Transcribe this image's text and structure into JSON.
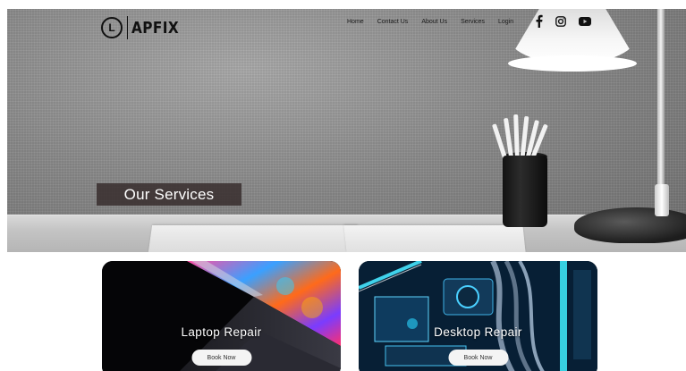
{
  "brand": {
    "logo_letter": "L",
    "name": "APFIX"
  },
  "nav": {
    "items": [
      "Home",
      "Contact Us",
      "About Us",
      "Services",
      "Login"
    ]
  },
  "social": [
    {
      "icon": "facebook-icon"
    },
    {
      "icon": "instagram-icon"
    },
    {
      "icon": "youtube-icon"
    }
  ],
  "hero": {
    "title": "Our Services"
  },
  "cards": [
    {
      "title": "Laptop Repair",
      "button": "Book Now"
    },
    {
      "title": "Desktop Repair",
      "button": "Book Now"
    }
  ],
  "colors": {
    "hero_title_bg": "#3a3030",
    "nav_text": "#1a1a1a",
    "button_bg": "#f4f4f4"
  }
}
